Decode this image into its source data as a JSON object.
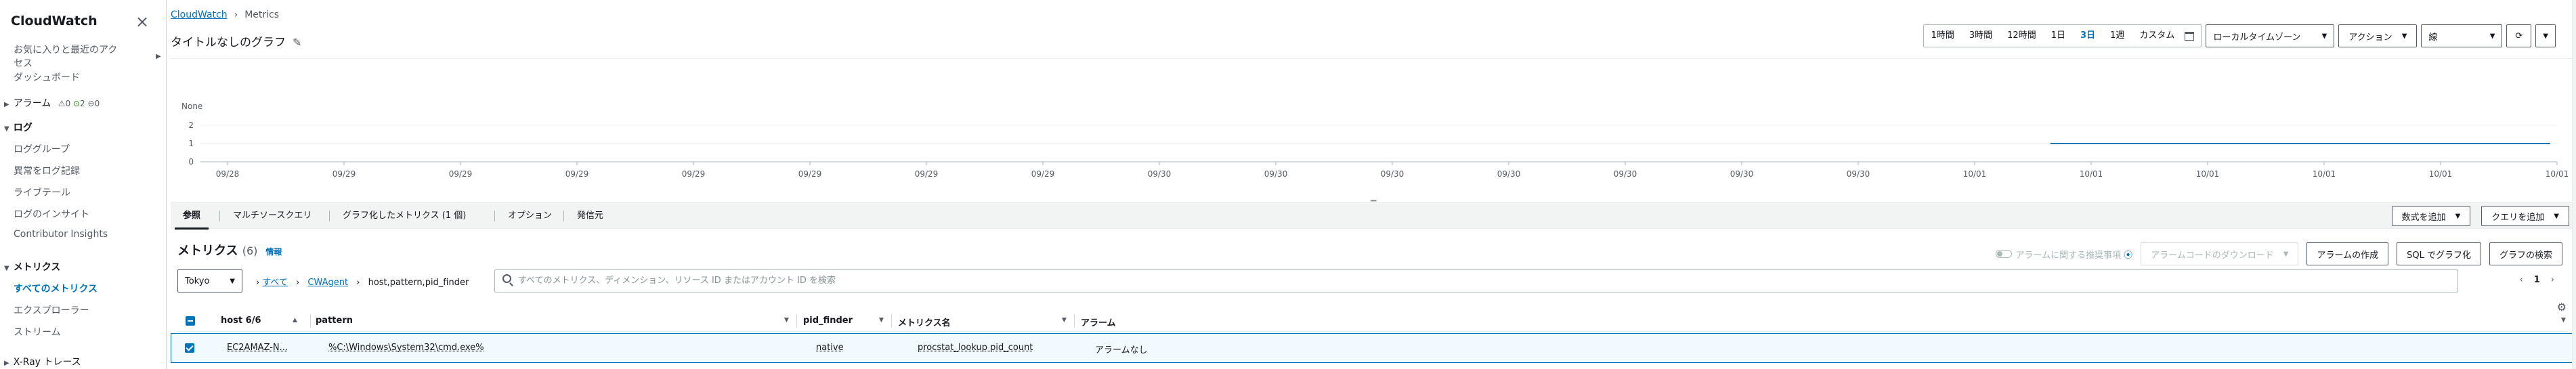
{
  "sidebar": {
    "title": "CloudWatch",
    "favorites": "お気に入りと最近のアクセス",
    "dashboard": "ダッシュボード",
    "alarms_label": "アラーム",
    "alarm_counts": {
      "in_alarm": "0",
      "ok": "2",
      "insufficient": "0"
    },
    "logs_label": "ログ",
    "log_items": [
      "ロググループ",
      "異常をログ記録",
      "ライブテール",
      "ログのインサイト",
      "Contributor Insights"
    ],
    "metrics_label": "メトリクス",
    "metrics_items": [
      "すべてのメトリクス",
      "エクスプローラー",
      "ストリーム"
    ],
    "xray_label": "X-Ray トレース"
  },
  "breadcrumb": {
    "root": "CloudWatch",
    "current": "Metrics"
  },
  "graph_title": "タイトルなしのグラフ",
  "toolbar": {
    "time_ranges": [
      "1時間",
      "3時間",
      "12時間",
      "1日",
      "3日",
      "1週",
      "カスタム"
    ],
    "selected_range": "3日",
    "timezone": "ローカルタイムゾーン",
    "actions": "アクション",
    "chart_type": "線"
  },
  "chart_data": {
    "type": "line",
    "ylabel": "None",
    "yticks": [
      "2",
      "1",
      "0"
    ],
    "x": [
      "09/28",
      "09/29",
      "09/29",
      "09/29",
      "09/29",
      "09/29",
      "09/29",
      "09/29",
      "09/30",
      "09/30",
      "09/30",
      "09/30",
      "09/30",
      "09/30",
      "09/30",
      "10/01",
      "10/01",
      "10/01",
      "10/01",
      "10/01",
      "10/01"
    ],
    "ylim": [
      0,
      2
    ],
    "series": [
      {
        "values": [
          null,
          null,
          null,
          null,
          null,
          null,
          null,
          null,
          null,
          null,
          null,
          null,
          null,
          null,
          null,
          1,
          1,
          1,
          1,
          1,
          1
        ]
      }
    ],
    "series_start_fraction": 0.785,
    "line_color": "#1f77b4"
  },
  "tabs": {
    "items": [
      "参照",
      "マルチソースクエリ",
      "グラフ化したメトリクス (1 個)",
      "オプション",
      "発信元"
    ],
    "active": "参照",
    "add_math": "数式を追加",
    "add_query": "クエリを追加"
  },
  "metrics": {
    "title": "メトリクス",
    "count": "(6)",
    "info": "情報",
    "toggle_label": "アラームに関する推奨事項",
    "download_alarm_code": "アラームコードのダウンロード",
    "create_alarm": "アラームの作成",
    "graph_with_sql": "SQL でグラフ化",
    "graph_search": "グラフの検索",
    "region": "Tokyo",
    "crumb_all": "すべて",
    "crumb_ns": "CWAgent",
    "crumb_dims": "host,pattern,pid_finder",
    "search_placeholder": "すべてのメトリクス、ディメンション、リソース ID またはアカウント ID を検索",
    "page": "1",
    "columns": [
      "host 6/6",
      "pattern",
      "pid_finder",
      "メトリクス名",
      "アラーム"
    ],
    "rows": [
      {
        "host": "EC2AMAZ-N...",
        "pattern": "%C:\\Windows\\System32\\cmd.exe%",
        "pid_finder": "native",
        "metric": "procstat_lookup pid_count",
        "alarm": "アラームなし"
      }
    ]
  }
}
